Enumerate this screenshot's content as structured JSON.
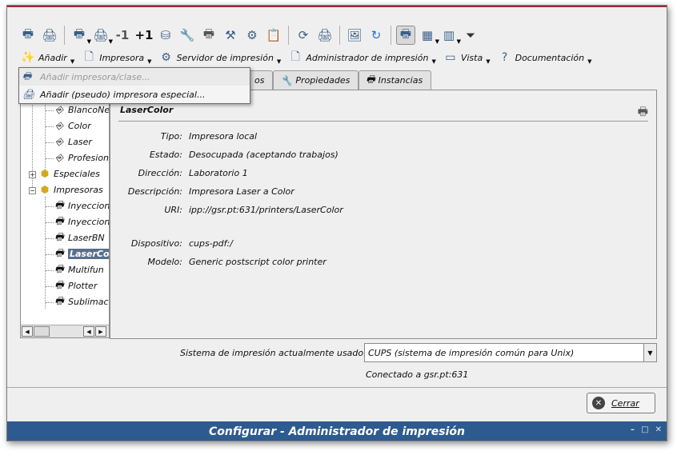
{
  "toolbar": {
    "icons": [
      "printer-add-icon",
      "printer-special-icon",
      "printer-list-icon",
      "printer-config-icon",
      "minus-one-icon",
      "plus-one-icon",
      "database-icon",
      "wrench-icon",
      "printer-icon",
      "tools-icon",
      "settings-gear-icon",
      "clipboard-icon",
      "refresh-icon",
      "printer-refresh-icon",
      "image-icon",
      "reload-icon",
      "printer-select-icon",
      "view-icon",
      "panel-icon",
      "filter-icon"
    ]
  },
  "menubar": {
    "items": [
      {
        "label": "Añadir",
        "icon": "wand-icon"
      },
      {
        "label": "Impresora",
        "icon": "document-icon"
      },
      {
        "label": "Servidor de impresión",
        "icon": "gear-icon"
      },
      {
        "label": "Administrador de impresión",
        "icon": "document-icon"
      },
      {
        "label": "Vista",
        "icon": "window-icon"
      },
      {
        "label": "Documentación",
        "icon": "help-icon"
      }
    ]
  },
  "popup": {
    "items": [
      {
        "label": "Añadir impresora/clase...",
        "disabled": true
      },
      {
        "label": "Añadir (pseudo) impresora especial...",
        "disabled": false
      }
    ]
  },
  "tabs": [
    {
      "label": "os",
      "icon": ""
    },
    {
      "label": "Propiedades",
      "icon": "wrench-icon"
    },
    {
      "label": "Instancias",
      "icon": "printer-icon"
    }
  ],
  "tree": {
    "items": [
      {
        "label": "BlancoNe",
        "icon": "class-icon",
        "level": 2
      },
      {
        "label": "Color",
        "icon": "class-icon",
        "level": 2
      },
      {
        "label": "Laser",
        "icon": "class-icon",
        "level": 2
      },
      {
        "label": "Profesion",
        "icon": "class-icon",
        "level": 2
      },
      {
        "label": "Especiales",
        "icon": "folder-icon",
        "level": 1
      },
      {
        "label": "Impresoras",
        "icon": "folder-icon",
        "level": 1
      },
      {
        "label": "Inyeccion",
        "icon": "printer-icon",
        "level": 2
      },
      {
        "label": "Inyeccion",
        "icon": "printer-icon",
        "level": 2
      },
      {
        "label": "LaserBN",
        "icon": "printer-icon",
        "level": 2
      },
      {
        "label": "LaserCol",
        "icon": "printer-icon",
        "level": 2,
        "selected": true
      },
      {
        "label": "Multifun",
        "icon": "printer-icon",
        "level": 2
      },
      {
        "label": "Plotter",
        "icon": "printer-icon",
        "level": 2
      },
      {
        "label": "Sublimac",
        "icon": "printer-icon",
        "level": 2
      }
    ]
  },
  "details": {
    "title": "LaserColor",
    "rows": [
      {
        "label": "Tipo:",
        "value": "Impresora local"
      },
      {
        "label": "Estado:",
        "value": "Desocupada (aceptando trabajos)"
      },
      {
        "label": "Dirección:",
        "value": "Laboratorio 1"
      },
      {
        "label": "Descripción:",
        "value": "Impresora Laser a Color"
      },
      {
        "label": "URI:",
        "value": "ipp://gsr.pt:631/printers/LaserColor"
      },
      {
        "label": "Dispositivo:",
        "value": "cups-pdf:/"
      },
      {
        "label": "Modelo:",
        "value": "Generic postscript color printer"
      }
    ]
  },
  "system": {
    "label": "Sistema de impresión actualmente usado:",
    "selected": "CUPS (sistema de impresión común para Unix)",
    "connected": "Conectado a gsr.pt:631"
  },
  "close_button": {
    "label": "Cerrar"
  },
  "window": {
    "title": "Configurar - Administrador de impresión",
    "controls": [
      "–",
      "□",
      "✕"
    ]
  }
}
